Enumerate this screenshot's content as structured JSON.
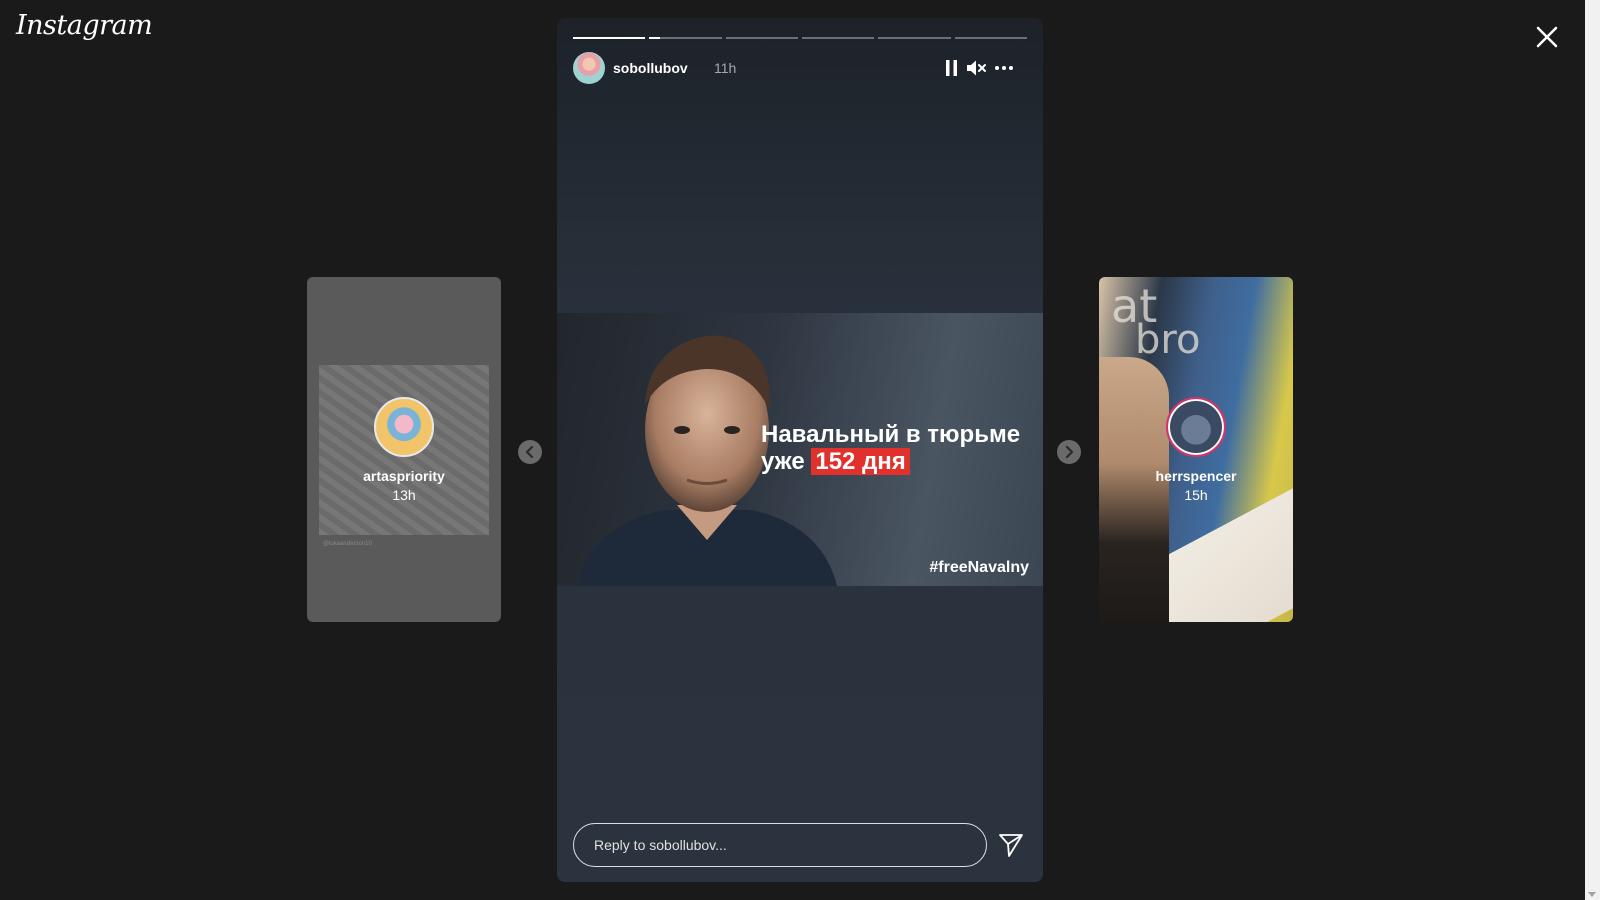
{
  "app": {
    "logo_text": "Instagram"
  },
  "icons": {
    "close": "close-icon",
    "prev": "chevron-left-icon",
    "next": "chevron-right-icon",
    "pause": "pause-icon",
    "mute": "volume-muted-icon",
    "more": "more-icon",
    "send": "send-icon"
  },
  "prev_preview": {
    "username": "artaspriority",
    "time": "13h",
    "caption": "@lukaanderson10"
  },
  "next_preview": {
    "username": "herrspencer",
    "time": "15h",
    "sketch_text_1": "at",
    "sketch_text_2": "bro"
  },
  "story": {
    "username": "sobollubov",
    "time": "11h",
    "segments": 6,
    "progress": [
      1.0,
      0.15,
      0,
      0,
      0,
      0
    ],
    "banner": {
      "headline_line1": "Навальный в тюрьме",
      "headline_prefix": "уже",
      "headline_highlight": "152 дня",
      "hashtag": "#freeNavalny"
    },
    "reply_placeholder": "Reply to sobollubov..."
  },
  "colors": {
    "background": "#1a1a1a",
    "highlight": "#e0312d"
  }
}
